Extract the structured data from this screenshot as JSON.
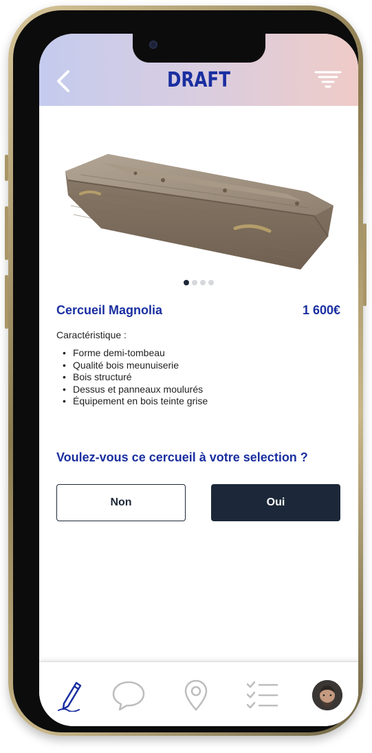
{
  "header": {
    "title": "DRAFT",
    "back_icon": "chevron-left-icon",
    "filter_icon": "filter-icon"
  },
  "product": {
    "name": "Cercueil Magnolia",
    "price": "1 600€",
    "image_icon": "coffin-image",
    "carousel": {
      "total": 4,
      "active": 1
    },
    "features_label": "Caractéristique :",
    "features": [
      "Forme demi-tombeau",
      "Qualité bois meunuiserie",
      "Bois structuré",
      "Dessus et panneaux moulurés",
      "Équipement en bois teinte grise"
    ]
  },
  "question": {
    "text": "Voulez-vous ce cercueil à votre selection ?",
    "no_label": "Non",
    "yes_label": "Oui"
  },
  "bottom_nav": {
    "items": [
      {
        "icon": "pen-icon",
        "active": true
      },
      {
        "icon": "chat-bubble-icon",
        "active": false
      },
      {
        "icon": "location-pin-icon",
        "active": false
      },
      {
        "icon": "checklist-icon",
        "active": false
      },
      {
        "icon": "avatar",
        "active": false
      }
    ]
  },
  "colors": {
    "accent": "#1a2fa0",
    "dark_button": "#1c2839",
    "header_gradient_start": "#c4cbee",
    "header_gradient_end": "#efcbc7",
    "inactive_icon": "#bdbdbd"
  }
}
